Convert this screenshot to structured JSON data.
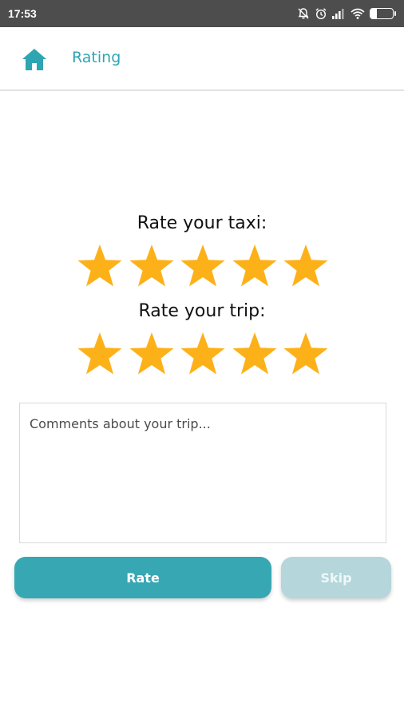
{
  "status_bar": {
    "time": "17:53",
    "battery_level": "30",
    "battery_fraction": 0.3,
    "icons": [
      "bell-off-icon",
      "alarm-icon",
      "signal-icon",
      "wifi-icon",
      "battery-icon"
    ]
  },
  "header": {
    "title": "Rating",
    "home_icon": "home-icon"
  },
  "taxi_rating": {
    "label": "Rate your taxi:",
    "stars": 5,
    "max": 5
  },
  "trip_rating": {
    "label": "Rate your trip:",
    "stars": 5,
    "max": 5
  },
  "comments": {
    "placeholder": "Comments about your trip...",
    "value": ""
  },
  "actions": {
    "rate_label": "Rate",
    "skip_label": "Skip"
  },
  "colors": {
    "accent": "#2ea5b3",
    "star": "#fdb119",
    "rate_button": "#37a7b4",
    "skip_button": "#b5d6da",
    "status_bar": "#4d4d4d"
  }
}
